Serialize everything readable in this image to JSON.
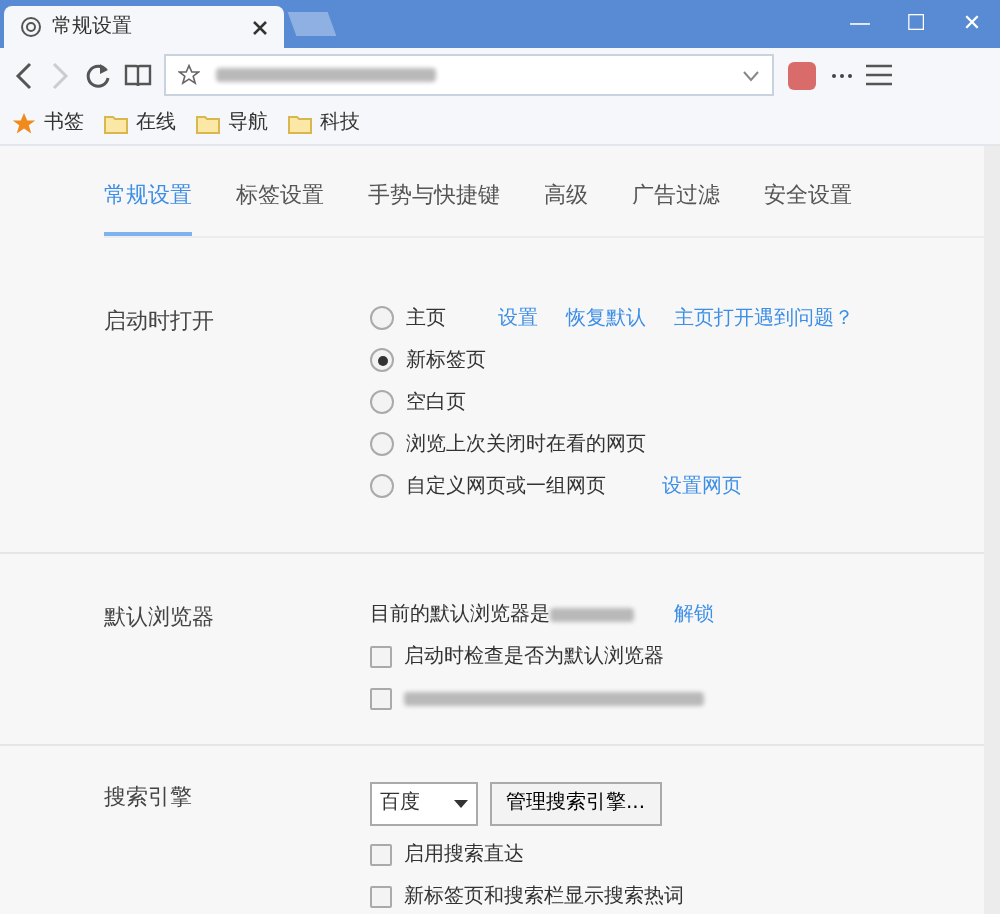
{
  "window": {
    "tab_title": "常规设置",
    "controls": [
      "—",
      "☐",
      "✕"
    ]
  },
  "bookmarks": [
    {
      "label": "书签",
      "kind": "star"
    },
    {
      "label": "在线",
      "kind": "folder"
    },
    {
      "label": "导航",
      "kind": "folder"
    },
    {
      "label": "科技",
      "kind": "folder"
    }
  ],
  "tabs": [
    {
      "label": "常规设置",
      "selected": true
    },
    {
      "label": "标签设置",
      "selected": false
    },
    {
      "label": "手势与快捷键",
      "selected": false
    },
    {
      "label": "高级",
      "selected": false
    },
    {
      "label": "广告过滤",
      "selected": false
    },
    {
      "label": "安全设置",
      "selected": false
    }
  ],
  "sections": [
    {
      "title": "启动时打开",
      "rows": [
        {
          "kind": "radio",
          "label": "主页",
          "selected": false,
          "links": [
            "设置",
            "恢复默认",
            "主页打开遇到问题？"
          ]
        },
        {
          "kind": "radio",
          "label": "新标签页",
          "selected": true
        },
        {
          "kind": "radio",
          "label": "空白页",
          "selected": false
        },
        {
          "kind": "radio",
          "label": "浏览上次关闭时在看的网页",
          "selected": false
        },
        {
          "kind": "radio",
          "label": "自定义网页或一组网页",
          "selected": false,
          "links": [
            "设置网页"
          ]
        }
      ]
    },
    {
      "title": "默认浏览器",
      "rows": [
        {
          "kind": "text",
          "label": "目前的默认浏览器是",
          "redacted": true,
          "links": [
            "解锁"
          ]
        },
        {
          "kind": "checkbox",
          "label": "启动时检查是否为默认浏览器",
          "checked": false
        },
        {
          "kind": "checkbox",
          "redacted": true,
          "checked": false
        }
      ]
    },
    {
      "title": "搜索引擎",
      "rows": [
        {
          "kind": "select",
          "value": "百度",
          "button": "管理搜索引擎..."
        },
        {
          "kind": "checkbox",
          "label": "启用搜索直达",
          "checked": false
        },
        {
          "kind": "checkbox",
          "label": "新标签页和搜索栏显示搜索热词",
          "checked": false
        }
      ]
    }
  ]
}
